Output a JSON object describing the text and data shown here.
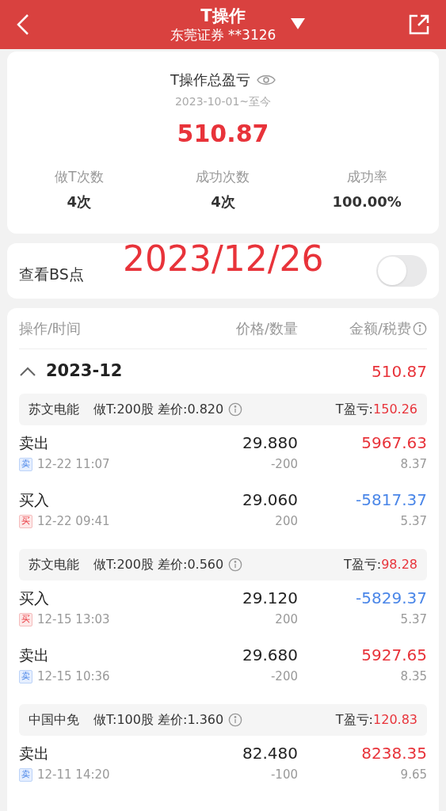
{
  "header": {
    "title": "T操作",
    "subtitle": "东莞证券 **3126"
  },
  "summary": {
    "title": "T操作总盈亏",
    "period": "2023-10-01~至今",
    "total": "510.87",
    "stats": [
      {
        "label": "做T次数",
        "value": "4次"
      },
      {
        "label": "成功次数",
        "value": "4次"
      },
      {
        "label": "成功率",
        "value": "100.00%"
      }
    ]
  },
  "bs_points": {
    "label": "查看BS点",
    "on": false,
    "annotation": "2023/12/26"
  },
  "table": {
    "columns": [
      "操作/时间",
      "价格/数量",
      "金额/税费"
    ],
    "months": [
      {
        "month": "2023-12",
        "expanded": true,
        "total": "510.87",
        "groups": [
          {
            "stock": "苏文电能",
            "detail": "做T:200股 差价:0.820",
            "profit_label": "T盈亏:",
            "profit": "150.26",
            "trades": [
              {
                "kind": "sell",
                "action": "卖出",
                "badge": "卖",
                "time": "12-22 11:07",
                "price": "29.880",
                "qty": "-200",
                "amount": "5967.63",
                "fee": "8.37"
              },
              {
                "kind": "buy",
                "action": "买入",
                "badge": "买",
                "time": "12-22 09:41",
                "price": "29.060",
                "qty": "200",
                "amount": "-5817.37",
                "fee": "5.37"
              }
            ]
          },
          {
            "stock": "苏文电能",
            "detail": "做T:200股 差价:0.560",
            "profit_label": "T盈亏:",
            "profit": "98.28",
            "trades": [
              {
                "kind": "buy",
                "action": "买入",
                "badge": "买",
                "time": "12-15 13:03",
                "price": "29.120",
                "qty": "200",
                "amount": "-5829.37",
                "fee": "5.37"
              },
              {
                "kind": "sell",
                "action": "卖出",
                "badge": "卖",
                "time": "12-15 10:36",
                "price": "29.680",
                "qty": "-200",
                "amount": "5927.65",
                "fee": "8.35"
              }
            ]
          },
          {
            "stock": "中国中免",
            "detail": "做T:100股 差价:1.360",
            "profit_label": "T盈亏:",
            "profit": "120.83",
            "trades": [
              {
                "kind": "sell",
                "action": "卖出",
                "badge": "卖",
                "time": "12-11 14:20",
                "price": "82.480",
                "qty": "-100",
                "amount": "8238.35",
                "fee": "9.65"
              }
            ]
          }
        ]
      }
    ]
  }
}
